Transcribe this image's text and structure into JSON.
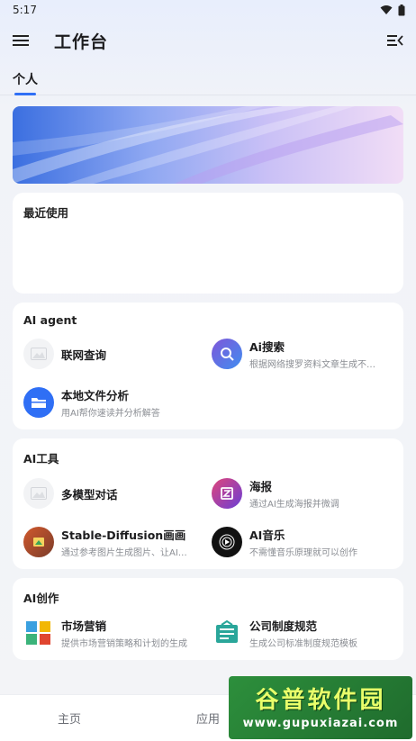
{
  "status_bar": {
    "time": "5:17"
  },
  "app_bar": {
    "title": "工作台"
  },
  "tabs": [
    {
      "label": "个人"
    }
  ],
  "recent": {
    "title": "最近使用"
  },
  "sections": [
    {
      "title": "AI agent",
      "items": [
        {
          "name": "联网查询",
          "desc": "",
          "icon": "image-placeholder-icon",
          "color": "#f2f3f5"
        },
        {
          "name": "Ai搜索",
          "desc": "根据网络搜罗资料文章生成不…",
          "icon": "ai-search-icon",
          "color": "#5b63d8"
        },
        {
          "name": "本地文件分析",
          "desc": "用AI帮你速读并分析解答",
          "icon": "folder-icon",
          "color": "#2f6ff5"
        }
      ]
    },
    {
      "title": "AI工具",
      "items": [
        {
          "name": "多模型对话",
          "desc": "",
          "icon": "image-placeholder-icon",
          "color": "#f2f3f5"
        },
        {
          "name": "海报",
          "desc": "通过AI生成海报并微调",
          "icon": "poster-icon",
          "color": "#c0396b"
        },
        {
          "name": "Stable-Diffusion画画",
          "desc": "通过参考图片生成图片、让AI…",
          "icon": "painting-icon",
          "color": "#c2532e"
        },
        {
          "name": "AI音乐",
          "desc": "不需懂音乐原理就可以创作",
          "icon": "music-icon",
          "color": "#111111"
        }
      ]
    },
    {
      "title": "AI创作",
      "items": [
        {
          "name": "市场营销",
          "desc": "提供市场营销策略和计划的生成",
          "icon": "marketing-cubes-icon",
          "color": "#3aa0e0"
        },
        {
          "name": "公司制度规范",
          "desc": "生成公司标准制度规范模板",
          "icon": "document-board-icon",
          "color": "#2aa69a"
        }
      ]
    }
  ],
  "bottom_nav": [
    {
      "label": "主页"
    },
    {
      "label": "应用"
    }
  ],
  "watermark": {
    "title": "谷普软件园",
    "url": "www.gupuxiazai.com"
  }
}
